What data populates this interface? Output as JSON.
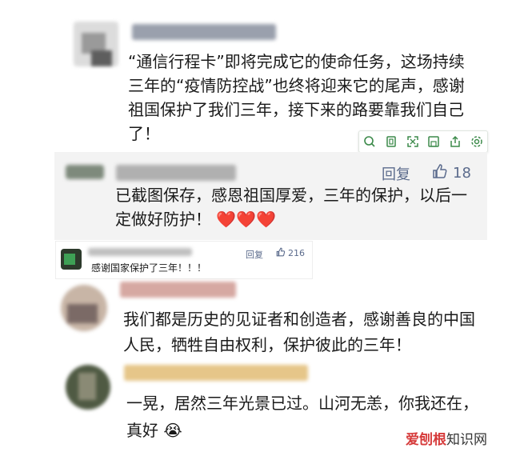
{
  "comments": [
    {
      "text": "“通信行程卡”即将完成它的使命任务，这场持续三年的“疫情防控战”也终将迎来它的尾声，感谢祖国保护了我们三年，接下来的路要靠我们自己了！"
    },
    {
      "reply_label": "回复",
      "like_count": "18",
      "text": "已截图保存，感恩祖国厚爱，三年的保护，以后一定做好防护！",
      "emoji": "❤️❤️❤️"
    },
    {
      "reply_label": "回复",
      "like_count": "216",
      "text": "感谢国家保护了三年！！！"
    },
    {
      "text": "我们都是历史的见证者和创造者，感谢善良的中国人民，牺牲自由权利，保护彼此的三年！"
    },
    {
      "text": "一晃，居然三年光景已过。山河无恙，你我还在，真好",
      "emoji": "😭"
    }
  ],
  "toolbar": {
    "icons": [
      "search-icon",
      "copy-icon",
      "expand-icon",
      "save-icon",
      "share-icon",
      "settings-icon"
    ]
  },
  "watermark": {
    "brand": "爱刨根",
    "suffix": "知识网"
  },
  "colors": {
    "reply_panel_bg": "#f3f3f3",
    "link_color": "#5b6b8c",
    "heart": "#ec4a64",
    "watermark_accent": "#d63b3b"
  }
}
